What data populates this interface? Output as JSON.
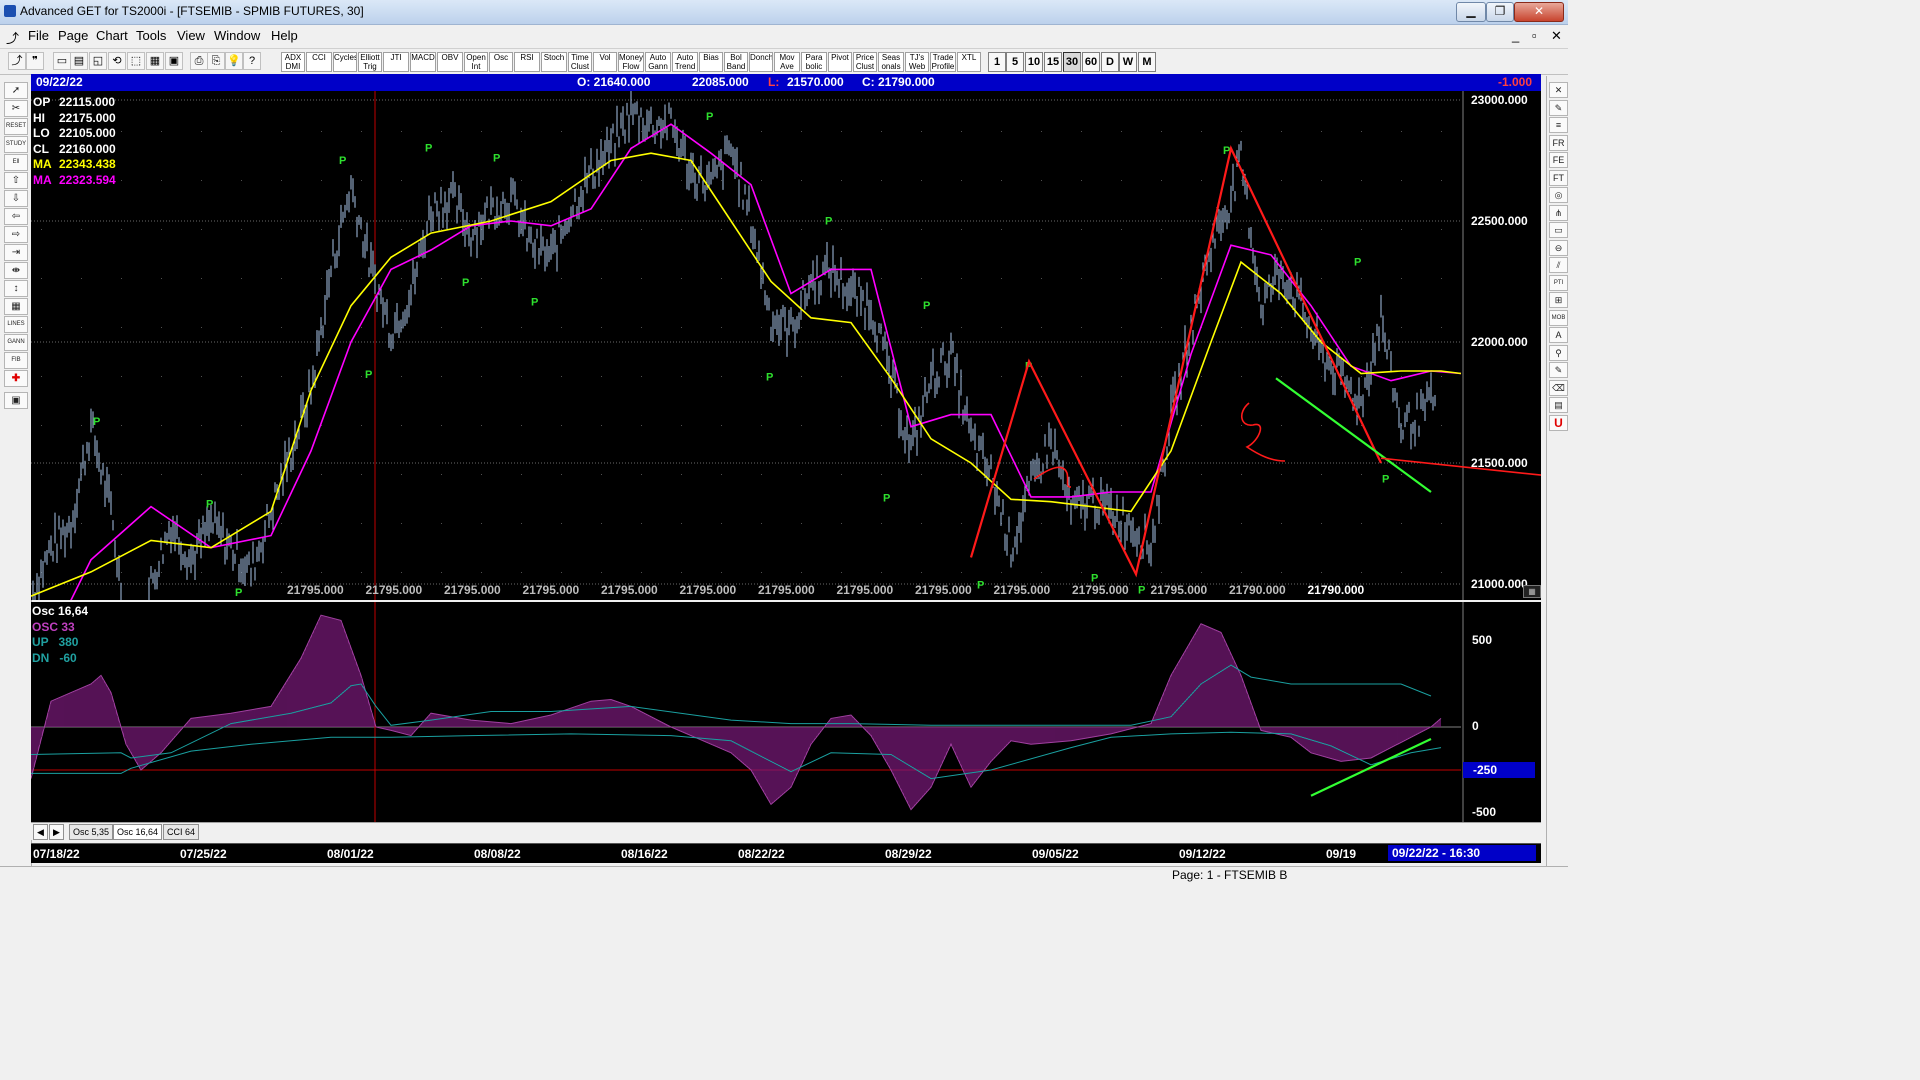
{
  "window": {
    "title": "Advanced GET for TS2000i - [FTSEMIB - SPMIB FUTURES, 30]",
    "minimize": "▁",
    "restore": "❐",
    "close": "✕"
  },
  "menu": [
    "File",
    "Page",
    "Chart",
    "Tools",
    "View",
    "Window",
    "Help"
  ],
  "mdi_controls": [
    "_",
    "▫",
    "✕"
  ],
  "toolbar": {
    "study_buttons": [
      "ADX DMI",
      "CCI",
      "Cycles",
      "Elliott Trig",
      "JTI",
      "MACD",
      "OBV",
      "Open Int",
      "Osc",
      "RSI",
      "Stoch",
      "Time Clust",
      "Vol",
      "Money Flow",
      "Auto Gann",
      "Auto Trend",
      "Bias",
      "Bol Band",
      "Donch",
      "Mov Ave",
      "Para bolic",
      "Pivot",
      "Price Clust",
      "Seas onals",
      "TJ's Web",
      "Trade Profile",
      "XTL"
    ],
    "timeframes": [
      "1",
      "5",
      "10",
      "15",
      "30",
      "60",
      "D",
      "W",
      "M"
    ],
    "active_timeframe": "30"
  },
  "header": {
    "date": "09/22/22",
    "open": "O: 21640.000",
    "high": "22085.000",
    "low_label": "L:",
    "low": "21570.000",
    "close": "C: 21790.000",
    "change": "-1.000"
  },
  "info_panel": [
    {
      "label": "OP",
      "value": "22115.000",
      "color": "#ffffff"
    },
    {
      "label": "HI",
      "value": "22175.000",
      "color": "#ffffff"
    },
    {
      "label": "LO",
      "value": "22105.000",
      "color": "#ffffff"
    },
    {
      "label": "CL",
      "value": "22160.000",
      "color": "#ffffff"
    },
    {
      "label": "MA",
      "value": "22343.438",
      "color": "#ffff00"
    },
    {
      "label": "MA",
      "value": "22323.594",
      "color": "#ff00ff"
    }
  ],
  "price_axis": [
    "23000.000",
    "22500.000",
    "22000.000",
    "21500.000",
    "21000.000"
  ],
  "bottom_values": [
    "21795.000",
    "21795.000",
    "21795.000",
    "21795.000",
    "21795.000",
    "21795.000",
    "21795.000",
    "21795.000",
    "21795.000",
    "21795.000",
    "21795.000",
    "21795.000",
    "21790.000",
    "21790.000"
  ],
  "pivot_label": "P",
  "osc_legend": [
    {
      "text": "Osc 16,64",
      "color": "#ffffff"
    },
    {
      "text": "OSC 33",
      "color": "#c040c0"
    },
    {
      "text": "UP   380",
      "color": "#20a0a0"
    },
    {
      "text": "DN   -60",
      "color": "#20a0a0"
    }
  ],
  "osc_axis": [
    "500",
    "0",
    "-250",
    "-500"
  ],
  "tabs": [
    "Osc 5,35",
    "Osc 16,64",
    "CCI 64"
  ],
  "dates": [
    "07/18/22",
    "07/25/22",
    "08/01/22",
    "08/08/22",
    "08/16/22",
    "08/22/22",
    "08/29/22",
    "09/05/22",
    "09/12/22",
    "09/19"
  ],
  "current_time": "09/22/22 - 16:30",
  "status_text": "Page: 1 - FTSEMIB B",
  "chart_data": {
    "type": "line",
    "y_range": [
      20500,
      23000
    ],
    "price_path": [
      [
        0,
        20950
      ],
      [
        20,
        21150
      ],
      [
        40,
        21250
      ],
      [
        60,
        21650
      ],
      [
        80,
        21300
      ],
      [
        100,
        20650
      ],
      [
        120,
        21000
      ],
      [
        140,
        21250
      ],
      [
        160,
        21100
      ],
      [
        180,
        21250
      ],
      [
        200,
        21150
      ],
      [
        220,
        21050
      ],
      [
        240,
        21300
      ],
      [
        260,
        21550
      ],
      [
        280,
        21800
      ],
      [
        300,
        22300
      ],
      [
        320,
        22650
      ],
      [
        340,
        22300
      ],
      [
        360,
        22050
      ],
      [
        380,
        22200
      ],
      [
        400,
        22550
      ],
      [
        420,
        22600
      ],
      [
        440,
        22450
      ],
      [
        460,
        22550
      ],
      [
        480,
        22600
      ],
      [
        500,
        22400
      ],
      [
        520,
        22350
      ],
      [
        540,
        22550
      ],
      [
        560,
        22700
      ],
      [
        580,
        22800
      ],
      [
        600,
        22950
      ],
      [
        620,
        22900
      ],
      [
        640,
        22900
      ],
      [
        660,
        22700
      ],
      [
        680,
        22650
      ],
      [
        700,
        22800
      ],
      [
        720,
        22500
      ],
      [
        740,
        22100
      ],
      [
        760,
        22050
      ],
      [
        780,
        22250
      ],
      [
        800,
        22300
      ],
      [
        820,
        22200
      ],
      [
        840,
        22150
      ],
      [
        860,
        21850
      ],
      [
        880,
        21550
      ],
      [
        900,
        21850
      ],
      [
        920,
        21950
      ],
      [
        940,
        21600
      ],
      [
        960,
        21450
      ],
      [
        980,
        21150
      ],
      [
        1000,
        21400
      ],
      [
        1020,
        21600
      ],
      [
        1040,
        21300
      ],
      [
        1060,
        21350
      ],
      [
        1080,
        21300
      ],
      [
        1100,
        21250
      ],
      [
        1120,
        21150
      ],
      [
        1140,
        21700
      ],
      [
        1160,
        22050
      ],
      [
        1180,
        22400
      ],
      [
        1200,
        22600
      ],
      [
        1210,
        22750
      ],
      [
        1230,
        22150
      ],
      [
        1250,
        22300
      ],
      [
        1270,
        22150
      ],
      [
        1290,
        21950
      ],
      [
        1310,
        21850
      ],
      [
        1330,
        21750
      ],
      [
        1350,
        22100
      ],
      [
        1370,
        21650
      ],
      [
        1390,
        21700
      ],
      [
        1410,
        21800
      ],
      [
        1430,
        21800
      ]
    ],
    "ma_yellow": [
      [
        0,
        20950
      ],
      [
        60,
        21050
      ],
      [
        120,
        21180
      ],
      [
        180,
        21150
      ],
      [
        240,
        21300
      ],
      [
        280,
        21800
      ],
      [
        320,
        22150
      ],
      [
        360,
        22350
      ],
      [
        400,
        22450
      ],
      [
        460,
        22500
      ],
      [
        520,
        22580
      ],
      [
        580,
        22750
      ],
      [
        620,
        22780
      ],
      [
        660,
        22750
      ],
      [
        700,
        22500
      ],
      [
        740,
        22250
      ],
      [
        780,
        22100
      ],
      [
        820,
        22080
      ],
      [
        860,
        21850
      ],
      [
        900,
        21600
      ],
      [
        940,
        21500
      ],
      [
        980,
        21350
      ],
      [
        1020,
        21340
      ],
      [
        1060,
        21320
      ],
      [
        1100,
        21300
      ],
      [
        1140,
        21550
      ],
      [
        1180,
        22000
      ],
      [
        1210,
        22330
      ],
      [
        1250,
        22200
      ],
      [
        1290,
        22000
      ],
      [
        1330,
        21870
      ],
      [
        1370,
        21880
      ],
      [
        1410,
        21880
      ],
      [
        1430,
        21870
      ]
    ],
    "ma_magenta": [
      [
        0,
        20600
      ],
      [
        60,
        21100
      ],
      [
        120,
        21320
      ],
      [
        180,
        21150
      ],
      [
        240,
        21200
      ],
      [
        280,
        21550
      ],
      [
        320,
        22000
      ],
      [
        360,
        22300
      ],
      [
        400,
        22380
      ],
      [
        440,
        22480
      ],
      [
        480,
        22500
      ],
      [
        520,
        22480
      ],
      [
        560,
        22550
      ],
      [
        600,
        22800
      ],
      [
        640,
        22900
      ],
      [
        680,
        22780
      ],
      [
        720,
        22650
      ],
      [
        760,
        22200
      ],
      [
        800,
        22300
      ],
      [
        840,
        22300
      ],
      [
        880,
        21650
      ],
      [
        920,
        21700
      ],
      [
        960,
        21700
      ],
      [
        1000,
        21360
      ],
      [
        1040,
        21360
      ],
      [
        1080,
        21380
      ],
      [
        1120,
        21380
      ],
      [
        1160,
        21950
      ],
      [
        1200,
        22400
      ],
      [
        1240,
        22360
      ],
      [
        1280,
        22150
      ],
      [
        1320,
        21900
      ],
      [
        1360,
        21840
      ],
      [
        1400,
        21880
      ],
      [
        1430,
        21870
      ]
    ],
    "annotations": {
      "red_zigzag_left": [
        [
          940,
          21110
        ],
        [
          998,
          21920
        ],
        [
          1105,
          21040
        ],
        [
          1200,
          22800
        ],
        [
          1350,
          21500
        ]
      ],
      "green_trend_main": [
        [
          1245,
          21850
        ],
        [
          1400,
          21380
        ]
      ],
      "red_horizontal": [
        [
          1350,
          21520
        ],
        [
          1510,
          21450
        ]
      ]
    },
    "oscillator": {
      "y_range": [
        -600,
        700
      ],
      "points": [
        [
          0,
          -300
        ],
        [
          20,
          150
        ],
        [
          40,
          200
        ],
        [
          60,
          250
        ],
        [
          70,
          300
        ],
        [
          80,
          200
        ],
        [
          95,
          -100
        ],
        [
          110,
          -250
        ],
        [
          130,
          -150
        ],
        [
          160,
          50
        ],
        [
          200,
          80
        ],
        [
          240,
          120
        ],
        [
          270,
          400
        ],
        [
          290,
          650
        ],
        [
          310,
          620
        ],
        [
          330,
          300
        ],
        [
          345,
          0
        ],
        [
          360,
          -20
        ],
        [
          380,
          -50
        ],
        [
          400,
          80
        ],
        [
          440,
          40
        ],
        [
          480,
          20
        ],
        [
          520,
          70
        ],
        [
          560,
          150
        ],
        [
          580,
          160
        ],
        [
          600,
          120
        ],
        [
          640,
          0
        ],
        [
          680,
          -100
        ],
        [
          700,
          -150
        ],
        [
          720,
          -250
        ],
        [
          740,
          -450
        ],
        [
          760,
          -350
        ],
        [
          780,
          -100
        ],
        [
          800,
          50
        ],
        [
          820,
          70
        ],
        [
          840,
          -50
        ],
        [
          860,
          -250
        ],
        [
          880,
          -480
        ],
        [
          900,
          -350
        ],
        [
          920,
          -100
        ],
        [
          940,
          -350
        ],
        [
          960,
          -200
        ],
        [
          980,
          -80
        ],
        [
          1000,
          -100
        ],
        [
          1040,
          -80
        ],
        [
          1080,
          -40
        ],
        [
          1120,
          20
        ],
        [
          1140,
          300
        ],
        [
          1160,
          500
        ],
        [
          1170,
          600
        ],
        [
          1190,
          550
        ],
        [
          1210,
          300
        ],
        [
          1230,
          -20
        ],
        [
          1260,
          -60
        ],
        [
          1280,
          -150
        ],
        [
          1310,
          -200
        ],
        [
          1340,
          -180
        ],
        [
          1360,
          -120
        ],
        [
          1380,
          -60
        ],
        [
          1400,
          0
        ],
        [
          1410,
          50
        ]
      ],
      "trend_upper": [
        [
          1280,
          -400
        ],
        [
          1400,
          -70
        ]
      ]
    }
  }
}
